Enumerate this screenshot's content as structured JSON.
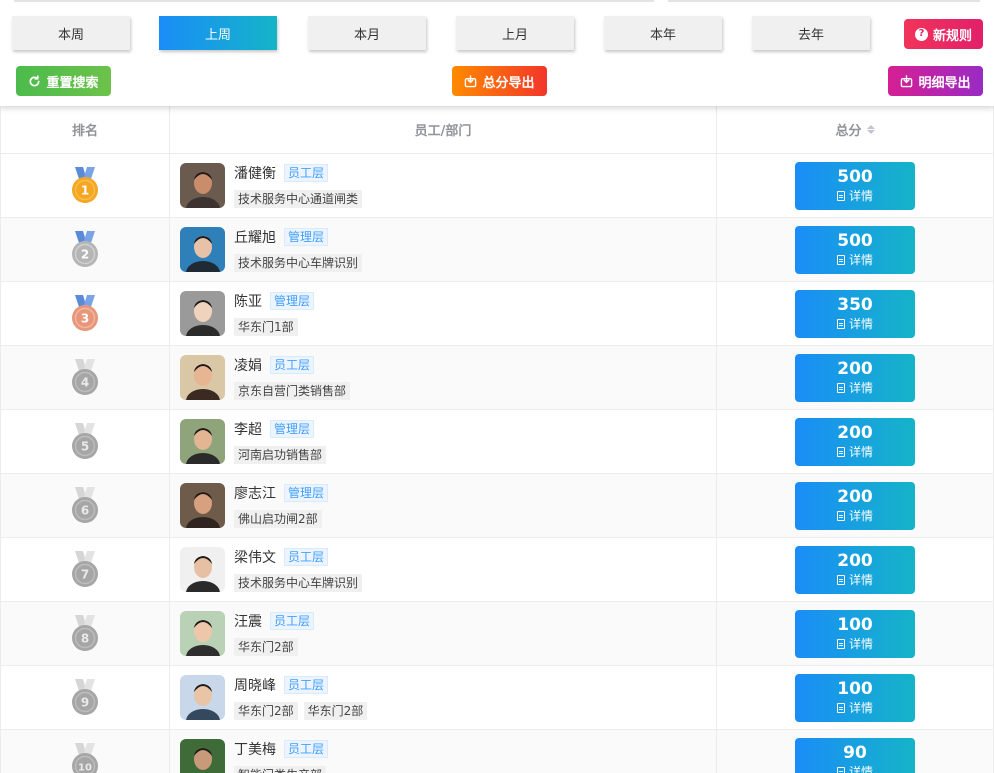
{
  "periods": [
    {
      "label": "本周",
      "active": false
    },
    {
      "label": "上周",
      "active": true
    },
    {
      "label": "本月",
      "active": false
    },
    {
      "label": "上月",
      "active": false
    },
    {
      "label": "本年",
      "active": false
    },
    {
      "label": "去年",
      "active": false
    }
  ],
  "actions": {
    "new_rule": "新规则",
    "reset_search": "重置搜索",
    "export_total": "总分导出",
    "export_detail": "明细导出"
  },
  "table": {
    "headers": {
      "rank": "排名",
      "employee": "员工/部门",
      "score": "总分"
    },
    "detail_label": "详情",
    "rows": [
      {
        "rank": "1",
        "name": "潘健衡",
        "role": "员工层",
        "depts": [
          "技术服务中心通道闸类"
        ],
        "score": "500"
      },
      {
        "rank": "2",
        "name": "丘耀旭",
        "role": "管理层",
        "depts": [
          "技术服务中心车牌识别"
        ],
        "score": "500"
      },
      {
        "rank": "3",
        "name": "陈亚",
        "role": "管理层",
        "depts": [
          "华东门1部"
        ],
        "score": "350"
      },
      {
        "rank": "4",
        "name": "凌娟",
        "role": "员工层",
        "depts": [
          "京东自营门类销售部"
        ],
        "score": "200"
      },
      {
        "rank": "5",
        "name": "李超",
        "role": "管理层",
        "depts": [
          "河南启功销售部"
        ],
        "score": "200"
      },
      {
        "rank": "6",
        "name": "廖志江",
        "role": "管理层",
        "depts": [
          "佛山启功闸2部"
        ],
        "score": "200"
      },
      {
        "rank": "7",
        "name": "梁伟文",
        "role": "员工层",
        "depts": [
          "技术服务中心车牌识别"
        ],
        "score": "200"
      },
      {
        "rank": "8",
        "name": "汪震",
        "role": "员工层",
        "depts": [
          "华东门2部"
        ],
        "score": "100"
      },
      {
        "rank": "9",
        "name": "周晓峰",
        "role": "员工层",
        "depts": [
          "华东门2部",
          "华东门2部"
        ],
        "score": "100"
      },
      {
        "rank": "10",
        "name": "丁美梅",
        "role": "员工层",
        "depts": [
          "智能门类生产部"
        ],
        "score": "90"
      }
    ]
  },
  "colors": {
    "accent_gradient_start": "#1a8df7",
    "accent_gradient_end": "#15b4c8",
    "gold": "#f5a623",
    "silver": "#b5b5b5",
    "bronze": "#e8967a",
    "grey_medal": "#a6a6a6",
    "medal_ribbon": "#5b8bd6",
    "role_tag_text": "#409eff"
  }
}
